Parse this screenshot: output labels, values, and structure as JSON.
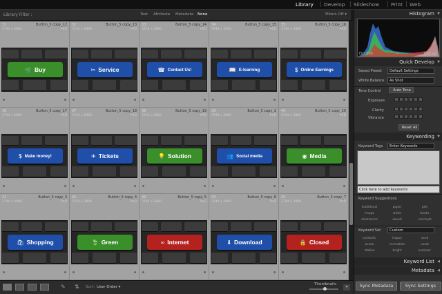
{
  "modules": {
    "items": [
      "Library",
      "Develop",
      "Slideshow",
      "Print",
      "Web"
    ],
    "active": "Library"
  },
  "filter_bar": {
    "title": "Library Filter :",
    "options": [
      "Text",
      "Attribute",
      "Metadata",
      "None"
    ],
    "active": "None",
    "filters_off": "Filters Off"
  },
  "grid": {
    "cells": [
      {
        "num": "31",
        "name": "Button_5 copy_12",
        "dims": "3744 x 2880",
        "ftype": "PSD",
        "label": "Buy",
        "icon": "cart-icon",
        "glyph": "🛒",
        "color": "#3a8f2a"
      },
      {
        "num": "32",
        "name": "Button_5 copy_13",
        "dims": "3744 x 2880",
        "ftype": "PSD",
        "label": "Service",
        "icon": "tools-icon",
        "glyph": "✂",
        "color": "#1f4fa8"
      },
      {
        "num": "33",
        "name": "Button_5 copy_14",
        "dims": "3744 x 2880",
        "ftype": "PSD",
        "label": "Contact Us!",
        "icon": "phone-icon",
        "glyph": "☎",
        "color": "#1f4fa8"
      },
      {
        "num": "34",
        "name": "Button_5 copy_15",
        "dims": "3744 x 2880",
        "ftype": "PSD",
        "label": "E-learning",
        "icon": "book-icon",
        "glyph": "📖",
        "color": "#1f4fa8"
      },
      {
        "num": "35",
        "name": "Button_5 copy_16",
        "dims": "3744 x 2880",
        "ftype": "PSD",
        "label": "Online Earnings",
        "icon": "money-icon",
        "glyph": "$",
        "color": "#1f4fa8"
      },
      {
        "num": "36",
        "name": "Button_5 copy_17",
        "dims": "3744 x 2880",
        "ftype": "PSD",
        "label": "Make money!",
        "icon": "moneybag-icon",
        "glyph": "$",
        "color": "#1f4fa8"
      },
      {
        "num": "37",
        "name": "Button_5 copy_18",
        "dims": "3744 x 2880",
        "ftype": "PSD",
        "label": "Tickets",
        "icon": "airplane-icon",
        "glyph": "✈",
        "color": "#1f4fa8"
      },
      {
        "num": "38",
        "name": "Button_5 copy_19",
        "dims": "3744 x 2880",
        "ftype": "PSD",
        "label": "Solution",
        "icon": "lightbulb-icon",
        "glyph": "💡",
        "color": "#3a8f2a"
      },
      {
        "num": "39",
        "name": "Button_5 copy_2",
        "dims": "3744 x 2880",
        "ftype": "PSD",
        "label": "Social media",
        "icon": "people-icon",
        "glyph": "👥",
        "color": "#1f4fa8"
      },
      {
        "num": "40",
        "name": "Button_5 copy_20",
        "dims": "3744 x 2880",
        "ftype": "PSD",
        "label": "Media",
        "icon": "rss-icon",
        "glyph": "◉",
        "color": "#3a8f2a"
      },
      {
        "num": "41",
        "name": "Button_5 copy_3",
        "dims": "3744 x 2880",
        "ftype": "PSD",
        "label": "Shopping",
        "icon": "basket-icon",
        "glyph": "🛍",
        "color": "#1f4fa8"
      },
      {
        "num": "42",
        "name": "Button_5 copy_4",
        "dims": "3744 x 2880",
        "ftype": "PSD",
        "label": "Green",
        "icon": "leaf-icon",
        "glyph": "🍃",
        "color": "#3a8f2a"
      },
      {
        "num": "43",
        "name": "Button_5 copy_5",
        "dims": "3744 x 2880",
        "ftype": "PSD",
        "label": "Internet",
        "icon": "link-icon",
        "glyph": "∞",
        "color": "#b3221e"
      },
      {
        "num": "44",
        "name": "Button_5 copy_6",
        "dims": "3744 x 2880",
        "ftype": "PSD",
        "label": "Download",
        "icon": "download-icon",
        "glyph": "⬇",
        "color": "#1f4fa8"
      },
      {
        "num": "45",
        "name": "Button_5 copy_7",
        "dims": "3744 x 2880",
        "ftype": "PSD",
        "label": "Closed",
        "icon": "lock-icon",
        "glyph": "🔒",
        "color": "#b3221e"
      }
    ]
  },
  "toolbar": {
    "sort_label": "Sort:",
    "sort_value": "User Order",
    "thumbnails_label": "Thumbnails"
  },
  "panel": {
    "histogram": {
      "title": "Histogram",
      "iso": "ISO 200",
      "focal": "—",
      "shutter": "1/40 sec"
    },
    "quick_develop": {
      "title": "Quick Develop",
      "saved_preset_label": "Saved Preset",
      "saved_preset_value": "Default Settings",
      "white_balance_label": "White Balance",
      "white_balance_value": "As Shot",
      "tone_control_label": "Tone Control",
      "auto_tone": "Auto Tone",
      "exposure": "Exposure",
      "clarity": "Clarity",
      "vibrance": "Vibrance",
      "reset_all": "Reset All"
    },
    "keywording": {
      "title": "Keywording",
      "tags_label": "Keyword Tags",
      "tags_value": "Enter Keywords",
      "click_here": "Click here to add keywords",
      "suggestions_label": "Keyword Suggestions",
      "suggestions": [
        "traditional",
        "paper",
        "pile",
        "image",
        "white",
        "books",
        "electronics",
        "sound",
        "concepts"
      ],
      "set_label": "Keyword Set",
      "set_value": "Custom",
      "set_words": [
        "symbolic",
        "happy",
        "sand",
        "ocean",
        "recreation",
        "coast",
        "station",
        "bright",
        "summer"
      ]
    },
    "keyword_list": {
      "title": "Keyword List"
    },
    "metadata": {
      "title": "Metadata"
    },
    "sync_metadata": "Sync Metadata",
    "sync_settings": "Sync Settings"
  }
}
